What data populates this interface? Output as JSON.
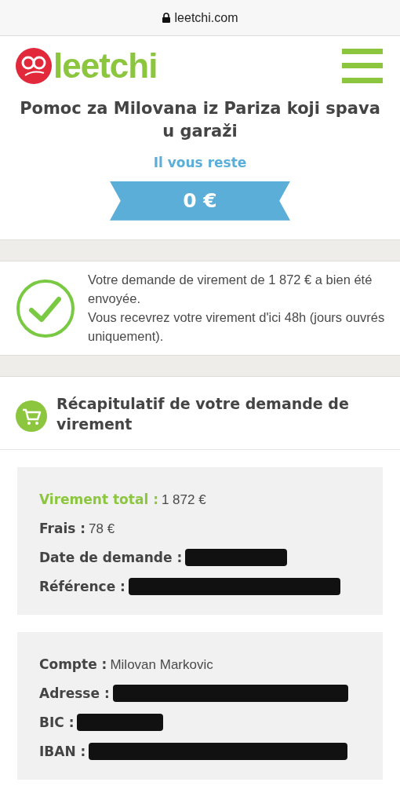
{
  "browser": {
    "url": "leetchi.com"
  },
  "header": {
    "logo": "leetchi"
  },
  "campaign": {
    "title": "Pomoc za Milovana iz Pariza koji spava u garaži",
    "remaining_label": "Il vous reste",
    "remaining_amount": "0 €"
  },
  "confirmation": {
    "lines": [
      "Votre demande de virement de 1 872 € a bien été envoyée.",
      "Vous recevrez votre virement d'ici 48h (jours ouvrés uniquement)."
    ]
  },
  "summary": {
    "title": "Récapitulatif de votre demande de virement",
    "cards": [
      {
        "rows": [
          {
            "kind": "text",
            "label": "Virement total :",
            "value": "1 872 €",
            "highlight": true
          },
          {
            "kind": "text",
            "label": "Frais :",
            "value": "78 €",
            "highlight": false
          },
          {
            "kind": "redacted",
            "label": "Date de demande :",
            "highlight": false
          },
          {
            "kind": "redacted",
            "label": "Référence :",
            "highlight": false
          }
        ]
      },
      {
        "rows": [
          {
            "kind": "text",
            "label": "Compte :",
            "value": "Milovan Markovic",
            "highlight": false
          },
          {
            "kind": "redacted",
            "label": "Adresse :",
            "highlight": false
          },
          {
            "kind": "redacted",
            "label": "BIC :",
            "highlight": false
          },
          {
            "kind": "redacted",
            "label": "IBAN :",
            "highlight": false
          }
        ]
      }
    ]
  }
}
